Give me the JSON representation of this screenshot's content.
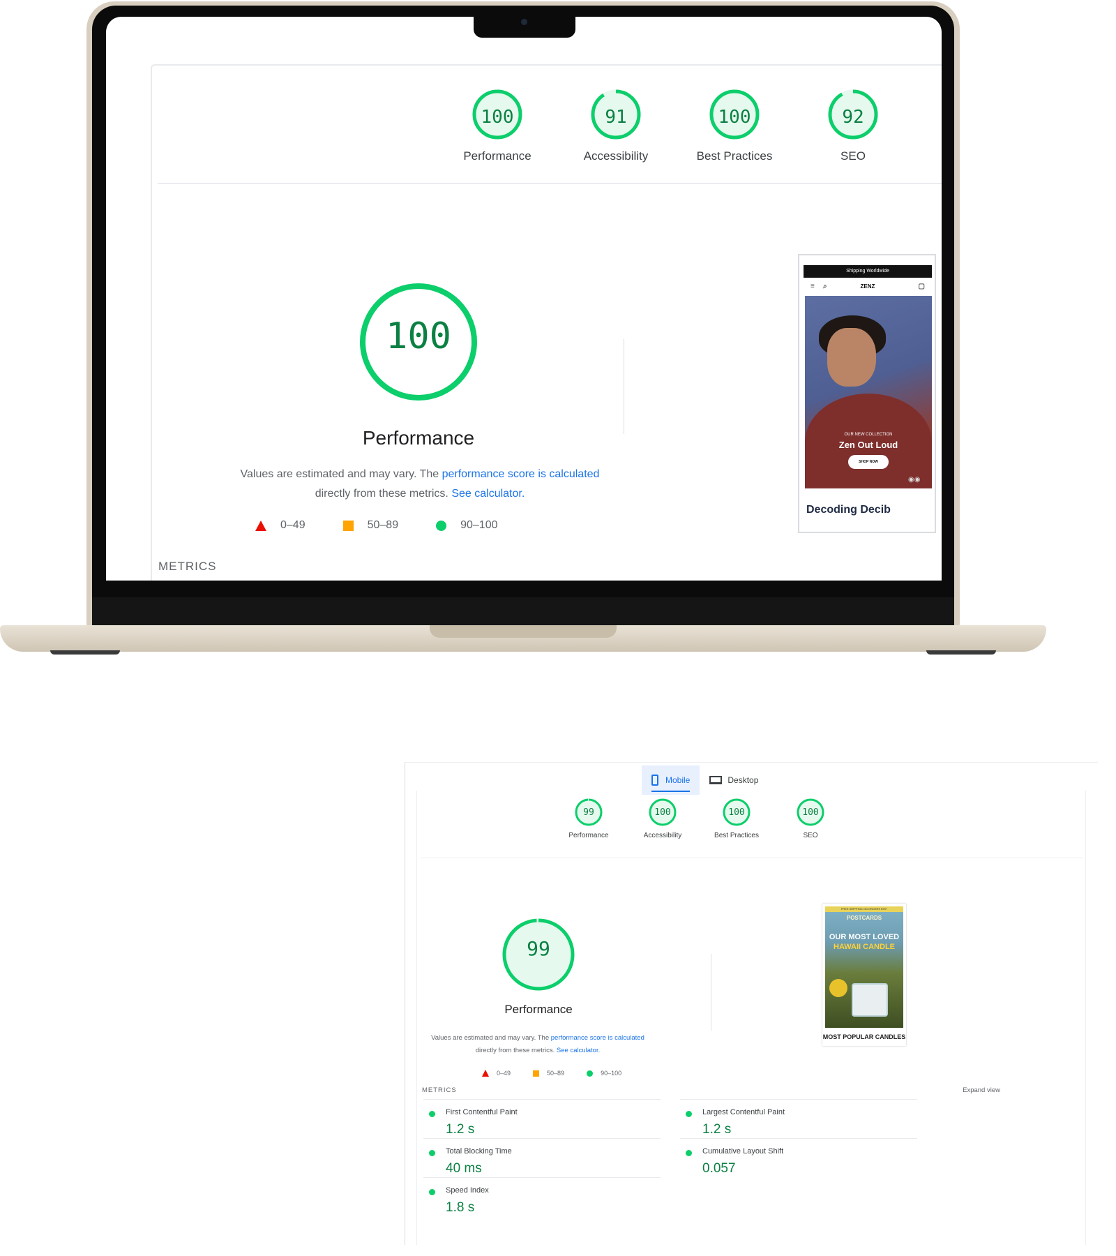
{
  "laptop_screen": {
    "category_scores": [
      {
        "label": "Performance",
        "score": "100"
      },
      {
        "label": "Accessibility",
        "score": "91"
      },
      {
        "label": "Best Practices",
        "score": "100"
      },
      {
        "label": "SEO",
        "score": "92"
      }
    ],
    "main_gauge": {
      "score": "100",
      "label": "Performance"
    },
    "description": {
      "text1": "Values are estimated and may vary. The ",
      "link1": "performance score is calculated",
      "text2": " directly from these metrics. ",
      "link2": "See calculator."
    },
    "legend": {
      "fail": "0–49",
      "average": "50–89",
      "pass": "90–100"
    },
    "metrics_heading": "METRICS",
    "preview": {
      "top_banner": "Shipping Worldwide",
      "brand": "ZENZ",
      "tagline": "OUR NEW COLLECTION",
      "hero_title": "Zen Out Loud",
      "shop_button": "SHOP NOW",
      "below_text": "Decoding Decib"
    }
  },
  "report": {
    "tabs": [
      {
        "label": "Mobile",
        "active": true
      },
      {
        "label": "Desktop",
        "active": false
      }
    ],
    "category_scores": [
      {
        "label": "Performance",
        "score": "99"
      },
      {
        "label": "Accessibility",
        "score": "100"
      },
      {
        "label": "Best Practices",
        "score": "100"
      },
      {
        "label": "SEO",
        "score": "100"
      }
    ],
    "main_gauge": {
      "score": "99",
      "label": "Performance"
    },
    "description": {
      "text1": "Values are estimated and may vary. The ",
      "link1": "performance score is calculated",
      "text2": " directly from these metrics. ",
      "link2": "See calculator."
    },
    "legend": {
      "fail": "0–49",
      "average": "50–89",
      "pass": "90–100"
    },
    "metrics_heading": "METRICS",
    "expand_view": "Expand view",
    "metrics": [
      {
        "name": "First Contentful Paint",
        "value": "1.2 s"
      },
      {
        "name": "Largest Contentful Paint",
        "value": "1.2 s"
      },
      {
        "name": "Total Blocking Time",
        "value": "40 ms"
      },
      {
        "name": "Cumulative Layout Shift",
        "value": "0.057"
      },
      {
        "name": "Speed Index",
        "value": "1.8 s"
      }
    ],
    "preview": {
      "banner": "FREE SHIPPING ON ORDERS $75+",
      "heading": "POSTCARDS",
      "title_line1": "OUR MOST LOVED",
      "title_line2": "HAWAII CANDLE",
      "caption": "MOST POPULAR CANDLES"
    }
  },
  "colors": {
    "pass_green": "#0cce6b",
    "pass_text": "#0b8043",
    "average_orange": "#ffa400",
    "fail_red": "#eb0f00",
    "link_blue": "#1a73e8"
  }
}
